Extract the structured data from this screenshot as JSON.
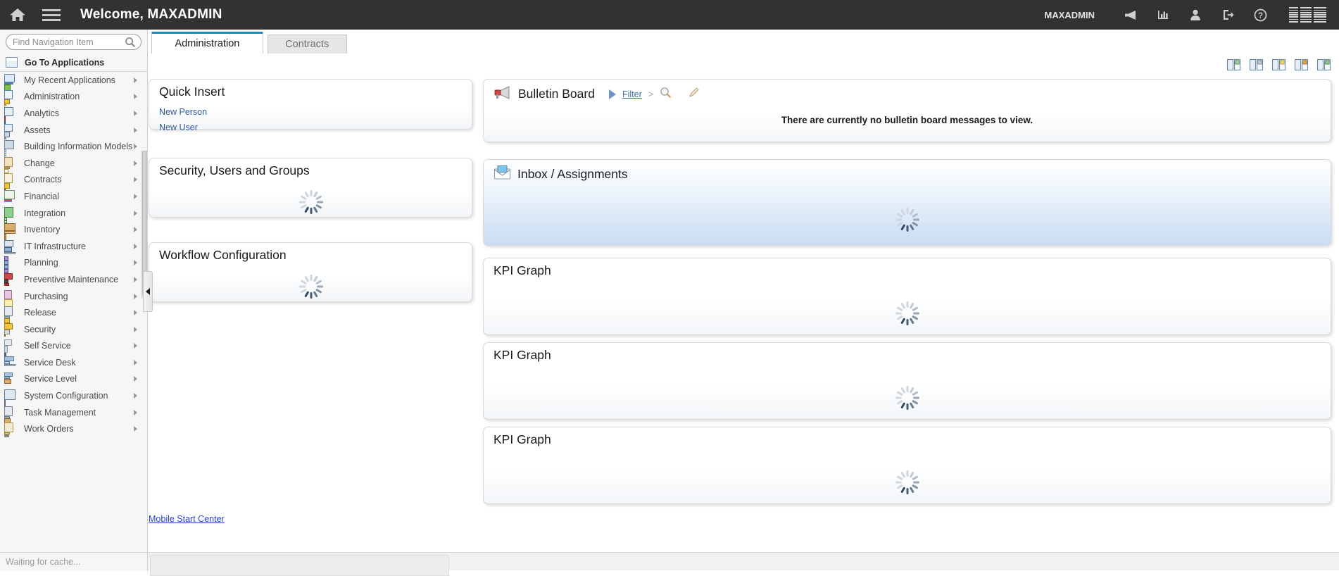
{
  "header": {
    "home_icon": "home-icon",
    "menu_icon": "hamburger-menu-icon",
    "welcome": "Welcome, MAXADMIN",
    "user": "MAXADMIN",
    "icons": [
      {
        "name": "bulletin-megaphone-icon",
        "title": "Bulletins"
      },
      {
        "name": "reports-chart-icon",
        "title": "Reports"
      },
      {
        "name": "profile-person-icon",
        "title": "Profile"
      },
      {
        "name": "sign-out-icon",
        "title": "Sign Out"
      },
      {
        "name": "help-question-icon",
        "title": "Help"
      }
    ],
    "brand": "IBM"
  },
  "sidebar": {
    "search": {
      "placeholder": "Find Navigation Item",
      "value": "",
      "icon": "search-magnifier-icon"
    },
    "go_to_applications": "Go To Applications",
    "items": [
      {
        "label": "My Recent Applications",
        "icon": "recent-applications-icon"
      },
      {
        "label": "Administration",
        "icon": "administration-key-icon"
      },
      {
        "label": "Analytics",
        "icon": "analytics-chart-icon"
      },
      {
        "label": "Assets",
        "icon": "assets-icon"
      },
      {
        "label": "Building Information Models",
        "icon": "building-icon"
      },
      {
        "label": "Change",
        "icon": "change-clipboard-icon"
      },
      {
        "label": "Contracts",
        "icon": "contracts-seal-icon"
      },
      {
        "label": "Financial",
        "icon": "financial-graph-icon"
      },
      {
        "label": "Integration",
        "icon": "integration-icon"
      },
      {
        "label": "Inventory",
        "icon": "inventory-box-icon"
      },
      {
        "label": "IT Infrastructure",
        "icon": "it-infrastructure-computer-icon"
      },
      {
        "label": "Planning",
        "icon": "planning-nodes-icon"
      },
      {
        "label": "Preventive Maintenance",
        "icon": "preventive-maintenance-oilcan-icon"
      },
      {
        "label": "Purchasing",
        "icon": "purchasing-documents-icon"
      },
      {
        "label": "Release",
        "icon": "release-clipboard-lock-icon"
      },
      {
        "label": "Security",
        "icon": "security-padlock-icon"
      },
      {
        "label": "Self Service",
        "icon": "self-service-cart-icon"
      },
      {
        "label": "Service Desk",
        "icon": "service-desk-bell-icon"
      },
      {
        "label": "Service Level",
        "icon": "service-level-icon"
      },
      {
        "label": "System Configuration",
        "icon": "system-configuration-sliders-icon"
      },
      {
        "label": "Task Management",
        "icon": "task-management-icon"
      },
      {
        "label": "Work Orders",
        "icon": "work-orders-clipboard-icon"
      }
    ]
  },
  "statusbar": {
    "text": "Waiting for cache..."
  },
  "tabs": [
    {
      "label": "Administration",
      "active": true
    },
    {
      "label": "Contracts",
      "active": false
    }
  ],
  "portlet_toolbar": [
    {
      "name": "change-content-layout-icon"
    },
    {
      "name": "display-settings-icon"
    },
    {
      "name": "create-new-start-center-icon"
    },
    {
      "name": "edit-portlet-icon"
    },
    {
      "name": "update-start-center-icon"
    }
  ],
  "left_column": [
    {
      "title": "Quick Insert",
      "icon": null,
      "links": [
        "New Person",
        "New User"
      ],
      "loading": false
    },
    {
      "title": "Security, Users and Groups",
      "icon": null,
      "links": [],
      "loading": true
    },
    {
      "title": "Workflow Configuration",
      "icon": null,
      "links": [],
      "loading": true
    }
  ],
  "mobile_link": "Mobile Start Center",
  "right_column": [
    {
      "title": "Bulletin Board",
      "icon": "megaphone-icon",
      "filter_label": "Filter",
      "separator": ">",
      "search_icon": "search-magnifier-icon",
      "edit_icon": "pencil-edit-icon",
      "message": "There are currently no bulletin board messages to view.",
      "loading": false,
      "blue": false
    },
    {
      "title": "Inbox / Assignments",
      "icon": "envelope-icon",
      "message": "",
      "loading": true,
      "blue": true
    },
    {
      "title": "KPI Graph",
      "icon": null,
      "message": "",
      "loading": true,
      "blue": false
    },
    {
      "title": "KPI Graph",
      "icon": null,
      "message": "",
      "loading": true,
      "blue": false
    },
    {
      "title": "KPI Graph",
      "icon": null,
      "message": "",
      "loading": true,
      "blue": false
    }
  ],
  "colors": {
    "header_bg": "#323232",
    "active_tab_accent": "#1a8bc4",
    "link": "#2f5b9c",
    "mobile_link": "#2346c9",
    "sidebar_bg": "#f6f6f6",
    "portlet_blue": "#c9ddf3"
  }
}
